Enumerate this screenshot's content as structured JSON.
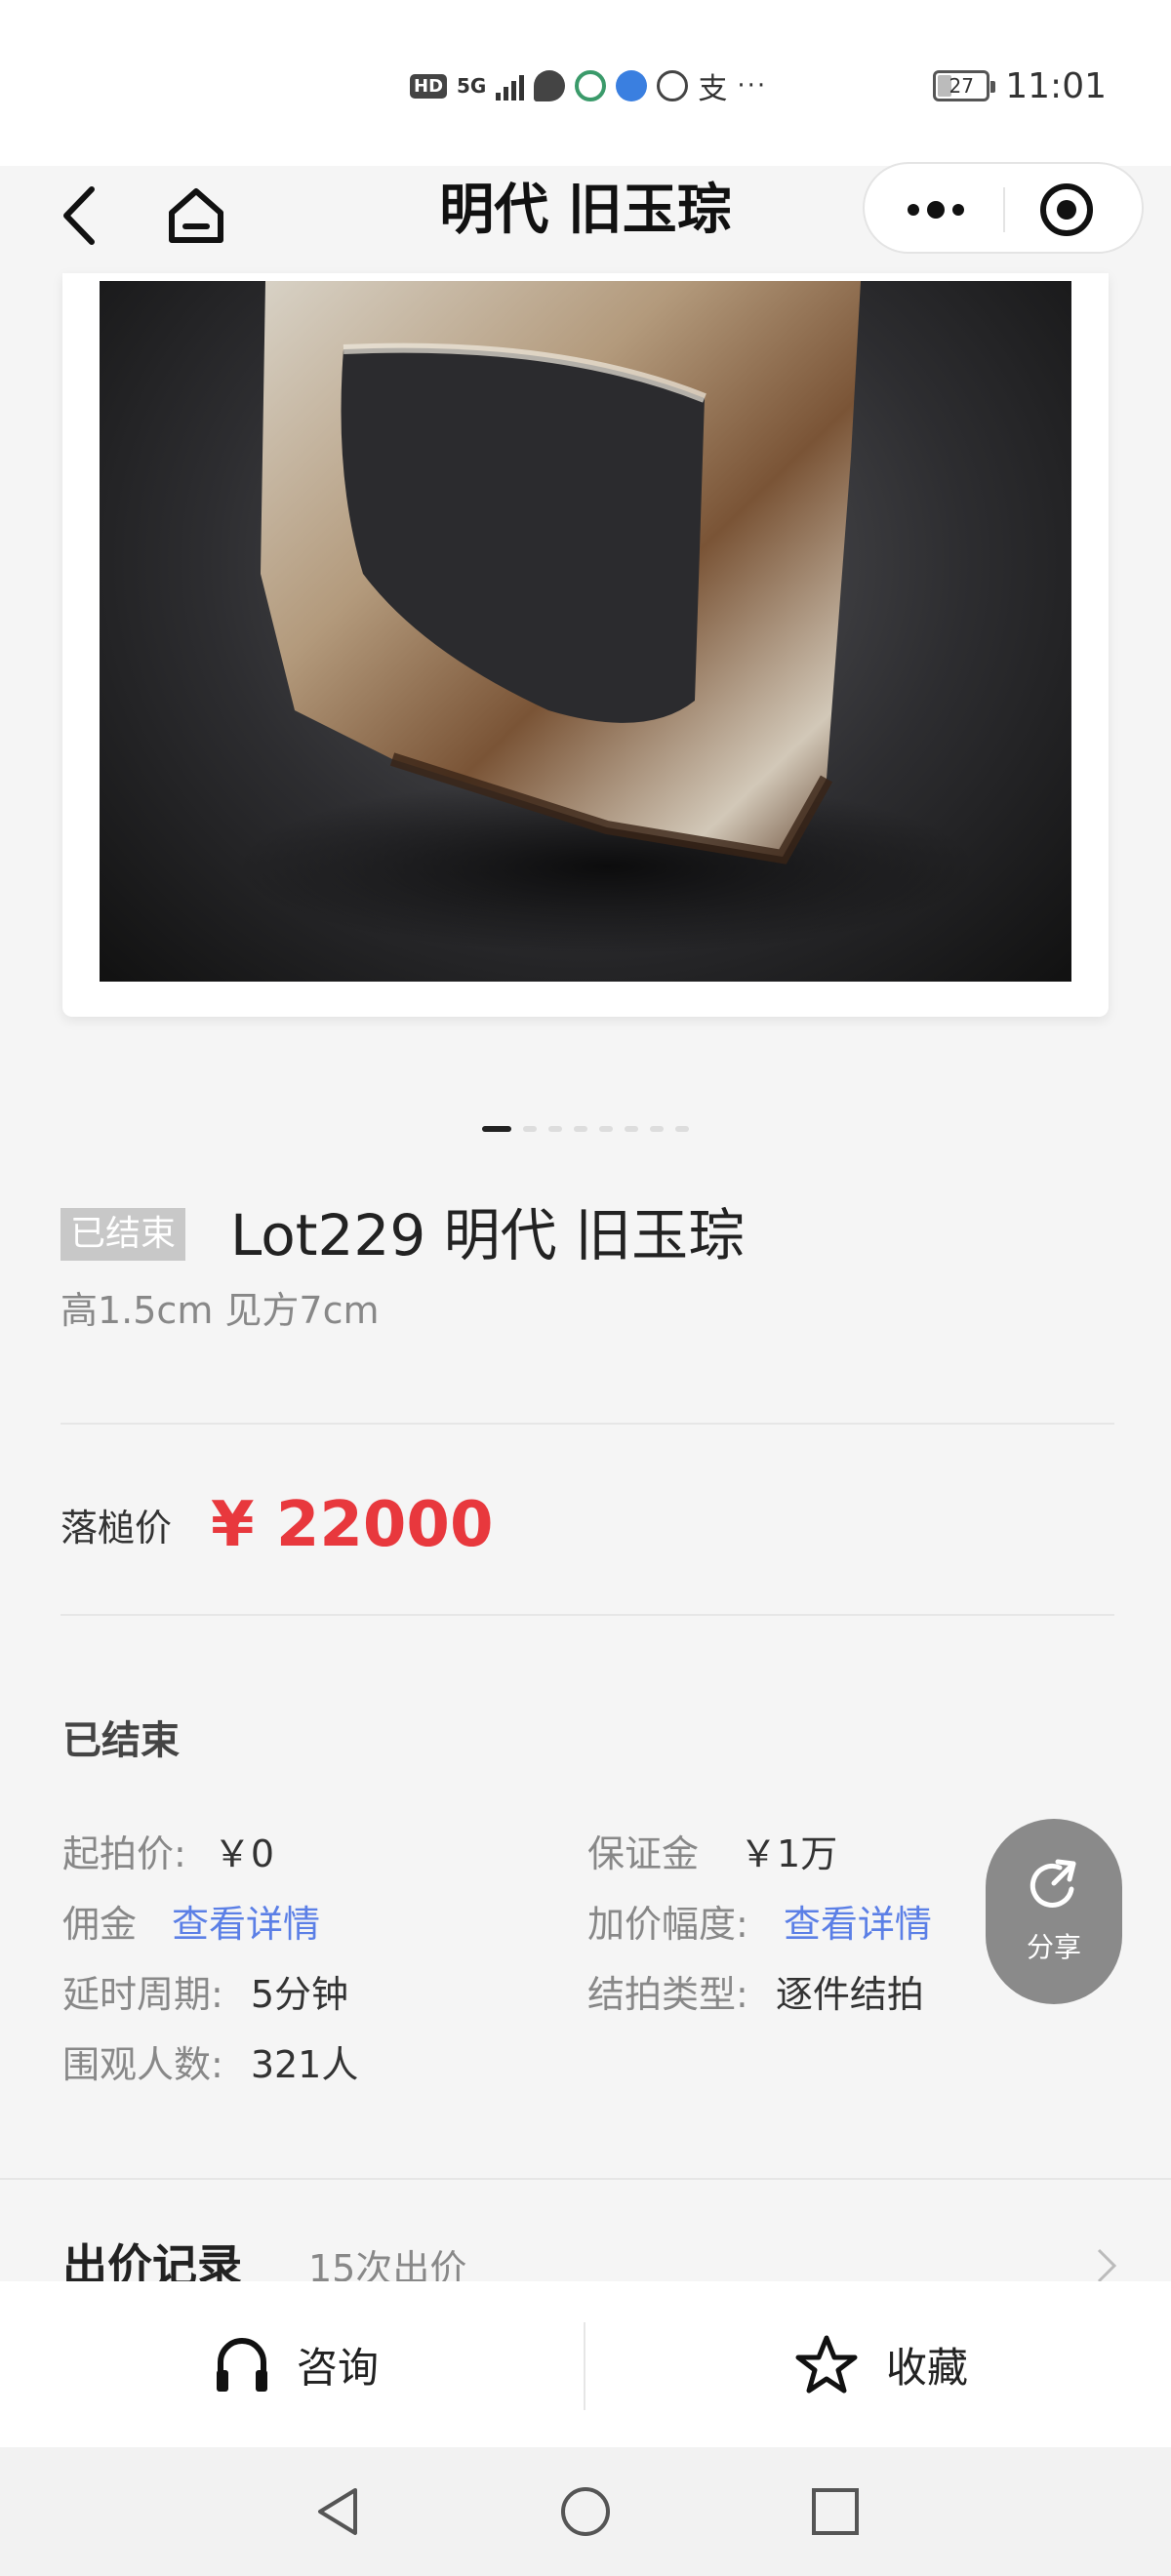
{
  "status_bar": {
    "time": "11:01",
    "battery": "27",
    "network": "5G",
    "hd_badge": "HD",
    "more_dots": "···",
    "pay_glyph": "支"
  },
  "nav": {
    "title": "明代 旧玉琮"
  },
  "gallery": {
    "dot_count": 8,
    "active_index": 0
  },
  "lot": {
    "status_tag": "已结束",
    "title": "Lot229 明代 旧玉琮",
    "size": "高1.5cm 见方7cm"
  },
  "price": {
    "label": "落槌价",
    "value": "¥ 22000",
    "color": "#e8383d"
  },
  "auction": {
    "state": "已结束",
    "rows": [
      {
        "key": "起拍价:",
        "value": "￥0"
      },
      {
        "key": "保证金",
        "value": "￥1万"
      },
      {
        "key": "佣金",
        "link": "查看详情"
      },
      {
        "key": "加价幅度:",
        "link": "查看详情"
      },
      {
        "key": "延时周期:",
        "value": "5分钟"
      },
      {
        "key": "结拍类型:",
        "value": "逐件结拍"
      },
      {
        "key": "围观人数:",
        "value": "321人"
      }
    ],
    "link_color": "#5b7fe6"
  },
  "share": {
    "label": "分享"
  },
  "bid_record": {
    "title": "出价记录",
    "count": "15次出价"
  },
  "actions": {
    "consult": "咨询",
    "favorite": "收藏"
  }
}
